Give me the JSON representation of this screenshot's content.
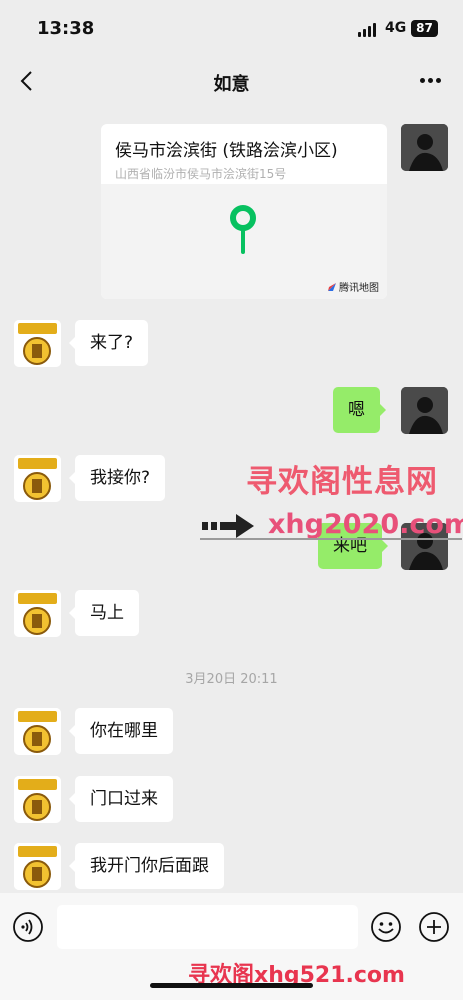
{
  "status_bar": {
    "time": "13:38",
    "network": "4G",
    "battery": "87"
  },
  "nav": {
    "title": "如意"
  },
  "location": {
    "name": "侯马市浍滨街 (铁路浍滨小区)",
    "address": "山西省临汾市侯马市浍滨街15号",
    "map_brand": "腾讯地图"
  },
  "messages": [
    {
      "text": "来了?"
    },
    {
      "text": "嗯"
    },
    {
      "text": "我接你?"
    },
    {
      "text": "来吧"
    },
    {
      "text": "马上"
    },
    {
      "text": "你在哪里"
    },
    {
      "text": "门口过来"
    },
    {
      "text": "我开门你后面跟"
    }
  ],
  "timestamp": "3月20日 20:11",
  "watermarks": {
    "site_cn": "寻欢阁性息网",
    "site_url": "xhg2020.com",
    "bottom": "寻欢阁xhg521.com"
  },
  "colors": {
    "background": "#ededed",
    "sent_bubble": "#95ec69",
    "map_pin": "#07c160",
    "watermark": "#e8507a"
  },
  "icons": [
    "back-icon",
    "more-icon",
    "map-pin-icon",
    "voice-icon",
    "emoji-icon",
    "plus-icon"
  ]
}
